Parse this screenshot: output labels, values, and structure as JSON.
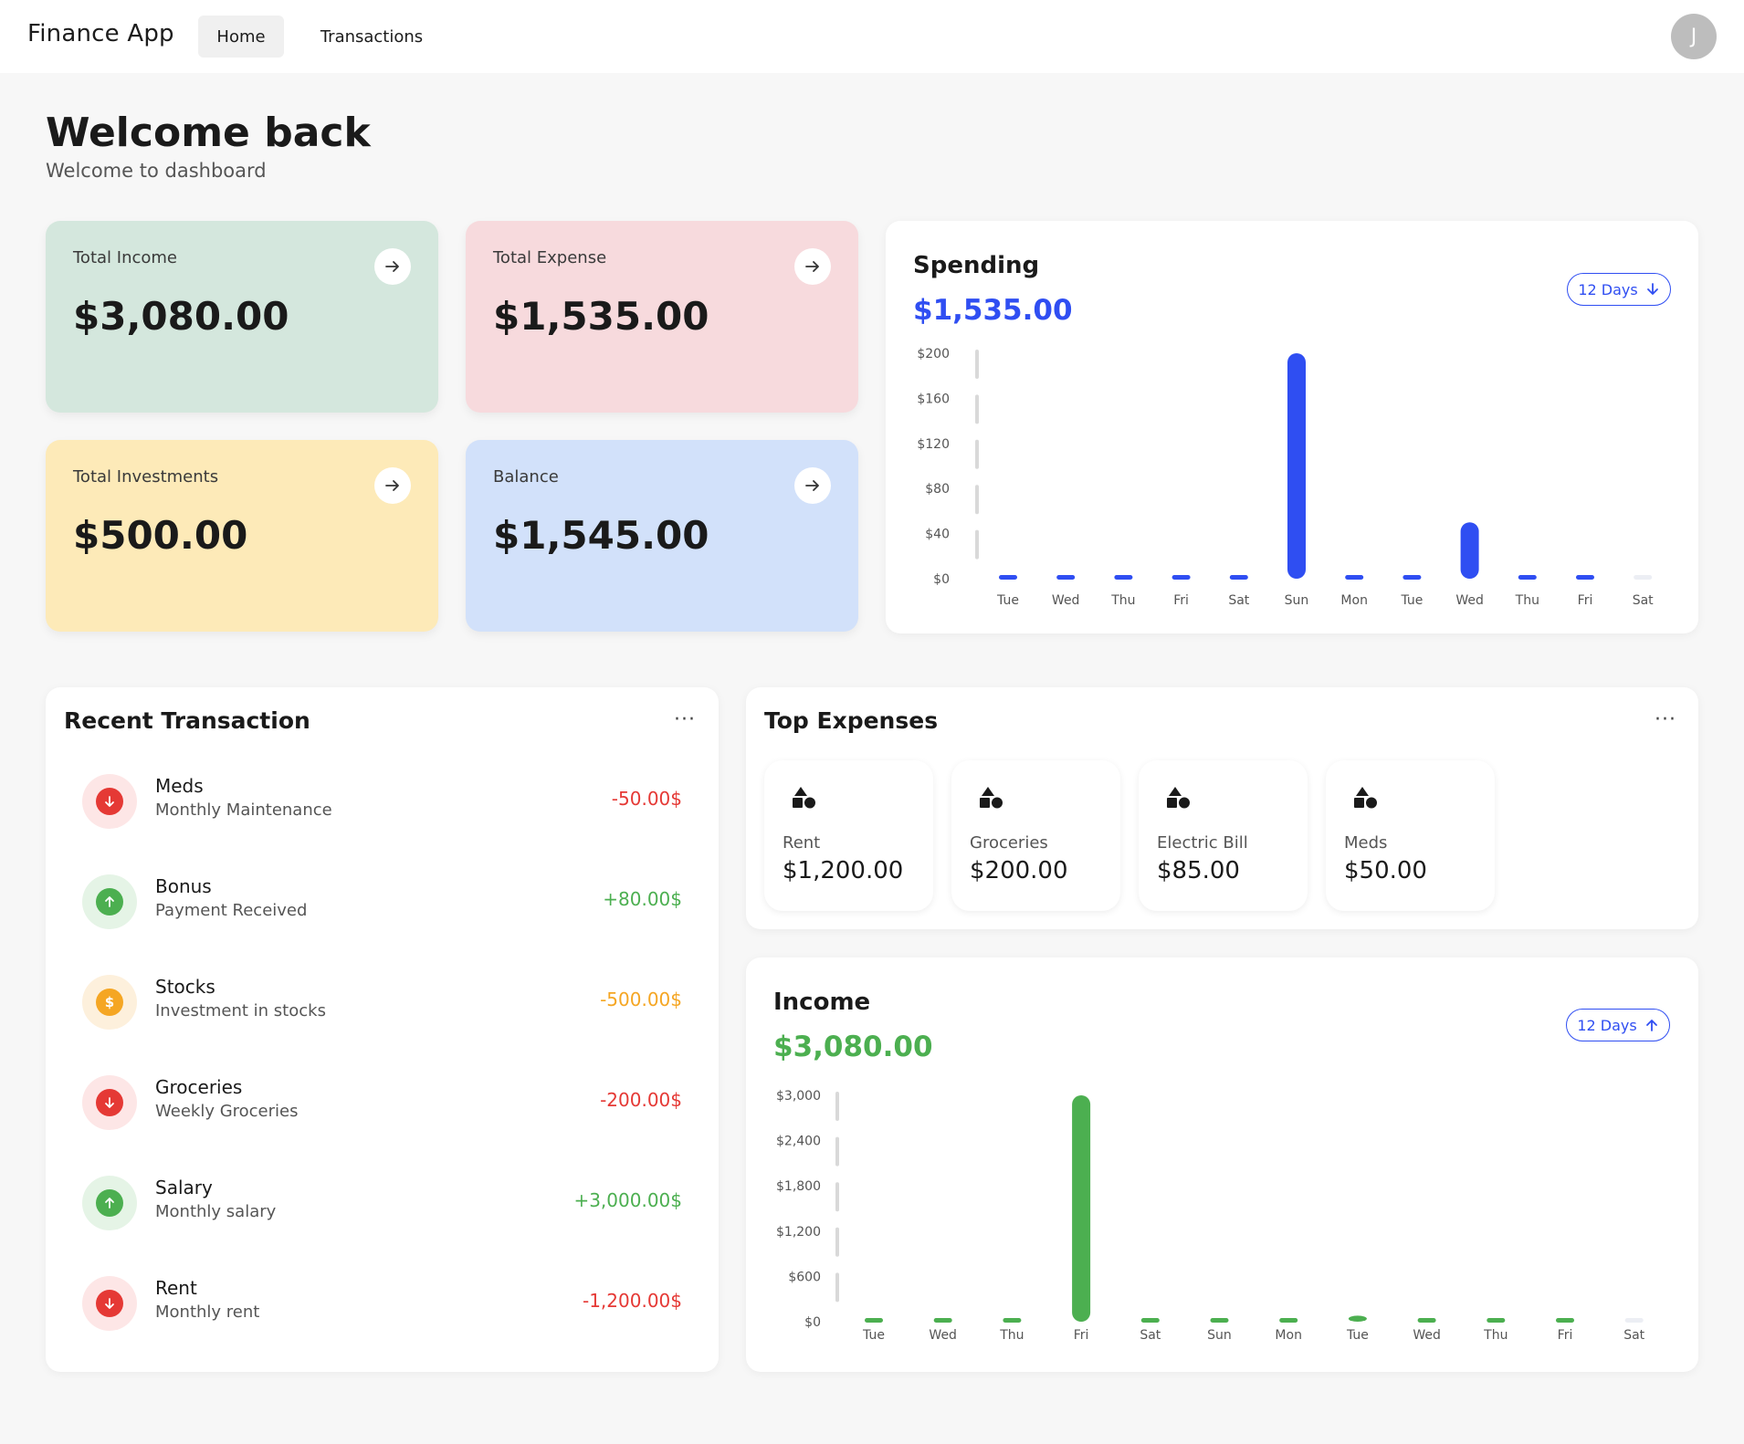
{
  "header": {
    "brand": "Finance App",
    "nav": {
      "home": "Home",
      "transactions": "Transactions"
    },
    "avatar_initial": "J"
  },
  "page": {
    "title": "Welcome back",
    "subtitle": "Welcome to dashboard"
  },
  "summary": {
    "income": {
      "label": "Total Income",
      "value": "$3,080.00"
    },
    "expense": {
      "label": "Total Expense",
      "value": "$1,535.00"
    },
    "investments": {
      "label": "Total Investments",
      "value": "$500.00"
    },
    "balance": {
      "label": "Balance",
      "value": "$1,545.00"
    }
  },
  "spending": {
    "title": "Spending",
    "amount": "$1,535.00",
    "range_label": "12 Days"
  },
  "income_panel": {
    "title": "Income",
    "amount": "$3,080.00",
    "range_label": "12 Days"
  },
  "recent": {
    "title": "Recent Transaction",
    "items": [
      {
        "name": "Meds",
        "desc": "Monthly Maintenance",
        "amount": "-50.00$",
        "kind": "expense"
      },
      {
        "name": "Bonus",
        "desc": "Payment Received",
        "amount": "+80.00$",
        "kind": "income"
      },
      {
        "name": "Stocks",
        "desc": "Investment in stocks",
        "amount": "-500.00$",
        "kind": "investment"
      },
      {
        "name": "Groceries",
        "desc": "Weekly Groceries",
        "amount": "-200.00$",
        "kind": "expense"
      },
      {
        "name": "Salary",
        "desc": "Monthly salary",
        "amount": "+3,000.00$",
        "kind": "income"
      },
      {
        "name": "Rent",
        "desc": "Monthly rent",
        "amount": "-1,200.00$",
        "kind": "expense"
      }
    ]
  },
  "top_expenses": {
    "title": "Top Expenses",
    "items": [
      {
        "label": "Rent",
        "value": "$1,200.00"
      },
      {
        "label": "Groceries",
        "value": "$200.00"
      },
      {
        "label": "Electric Bill",
        "value": "$85.00"
      },
      {
        "label": "Meds",
        "value": "$50.00"
      }
    ]
  },
  "colors": {
    "accent_blue": "#2f4ef2",
    "income_green": "#4caf50",
    "expense_red": "#e53935",
    "investment_orange": "#f5a623"
  },
  "chart_data": [
    {
      "type": "bar",
      "title": "Spending",
      "categories": [
        "Tue",
        "Wed",
        "Thu",
        "Fri",
        "Sat",
        "Sun",
        "Mon",
        "Tue",
        "Wed",
        "Thu",
        "Fri",
        "Sat"
      ],
      "values": [
        0,
        0,
        0,
        0,
        0,
        200,
        0,
        0,
        50,
        0,
        0,
        0
      ],
      "yticks": [
        "$0",
        "$40",
        "$80",
        "$120",
        "$160",
        "$200"
      ],
      "ylim": [
        0,
        200
      ],
      "color": "#2f4ef2"
    },
    {
      "type": "bar",
      "title": "Income",
      "categories": [
        "Tue",
        "Wed",
        "Thu",
        "Fri",
        "Sat",
        "Sun",
        "Mon",
        "Tue",
        "Wed",
        "Thu",
        "Fri",
        "Sat"
      ],
      "values": [
        0,
        0,
        0,
        3000,
        0,
        0,
        0,
        80,
        0,
        0,
        0,
        0
      ],
      "yticks": [
        "$0",
        "$600",
        "$1,200",
        "$1,800",
        "$2,400",
        "$3,000"
      ],
      "ylim": [
        0,
        3000
      ],
      "color": "#4caf50"
    }
  ]
}
